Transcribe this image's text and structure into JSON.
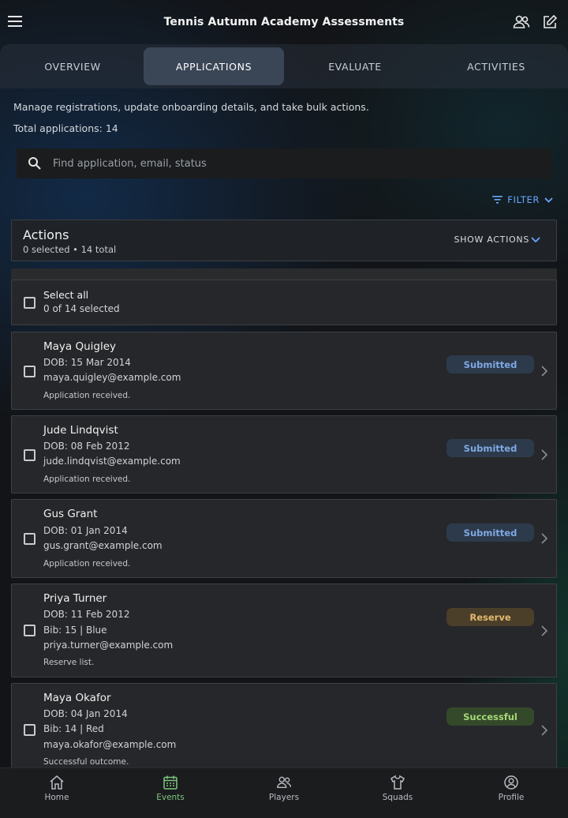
{
  "app": {
    "title": "Tennis Autumn Academy Assessments"
  },
  "tabs": [
    {
      "label": "OVERVIEW",
      "active": false
    },
    {
      "label": "APPLICATIONS",
      "active": true
    },
    {
      "label": "EVALUATE",
      "active": false
    },
    {
      "label": "ACTIVITIES",
      "active": false
    }
  ],
  "intro": {
    "description": "Manage registrations, update onboarding details, and take bulk actions.",
    "total": "Total applications: 14"
  },
  "search": {
    "placeholder": "Find application, email, status",
    "value": ""
  },
  "filter": {
    "label": "FILTER"
  },
  "actions": {
    "title": "Actions",
    "subtitle": "0 selected • 14 total",
    "show_label": "SHOW ACTIONS"
  },
  "select_all": {
    "label": "Select all",
    "count": "0 of 14 selected"
  },
  "applications": [
    {
      "name": "Maya Quigley",
      "dob": "DOB: 15 Mar 2014",
      "bib": "",
      "email": "maya.quigley@example.com",
      "note": "Application received.",
      "status": "Submitted",
      "status_kind": "submitted"
    },
    {
      "name": "Jude Lindqvist",
      "dob": "DOB: 08 Feb 2012",
      "bib": "",
      "email": "jude.lindqvist@example.com",
      "note": "Application received.",
      "status": "Submitted",
      "status_kind": "submitted"
    },
    {
      "name": "Gus Grant",
      "dob": "DOB: 01 Jan 2014",
      "bib": "",
      "email": "gus.grant@example.com",
      "note": "Application received.",
      "status": "Submitted",
      "status_kind": "submitted"
    },
    {
      "name": "Priya Turner",
      "dob": "DOB: 11 Feb 2012",
      "bib": "Bib: 15 | Blue",
      "email": "priya.turner@example.com",
      "note": "Reserve list.",
      "status": "Reserve",
      "status_kind": "reserve"
    },
    {
      "name": "Maya Okafor",
      "dob": "DOB: 04 Jan 2014",
      "bib": "Bib: 14 | Red",
      "email": "maya.okafor@example.com",
      "note": "Successful outcome.",
      "status": "Successful",
      "status_kind": "successful"
    }
  ],
  "bottom_nav": [
    {
      "label": "Home",
      "icon": "home-icon",
      "active": false
    },
    {
      "label": "Events",
      "icon": "calendar-icon",
      "active": true
    },
    {
      "label": "Players",
      "icon": "players-icon",
      "active": false
    },
    {
      "label": "Squads",
      "icon": "shirt-icon",
      "active": false
    },
    {
      "label": "Profile",
      "icon": "profile-icon",
      "active": false
    }
  ],
  "colors": {
    "accent_blue": "#6aa7ff",
    "active_nav": "#7cc67f",
    "submitted": "#7fa8e2",
    "reserve": "#e3b870",
    "successful": "#a6d87a"
  }
}
